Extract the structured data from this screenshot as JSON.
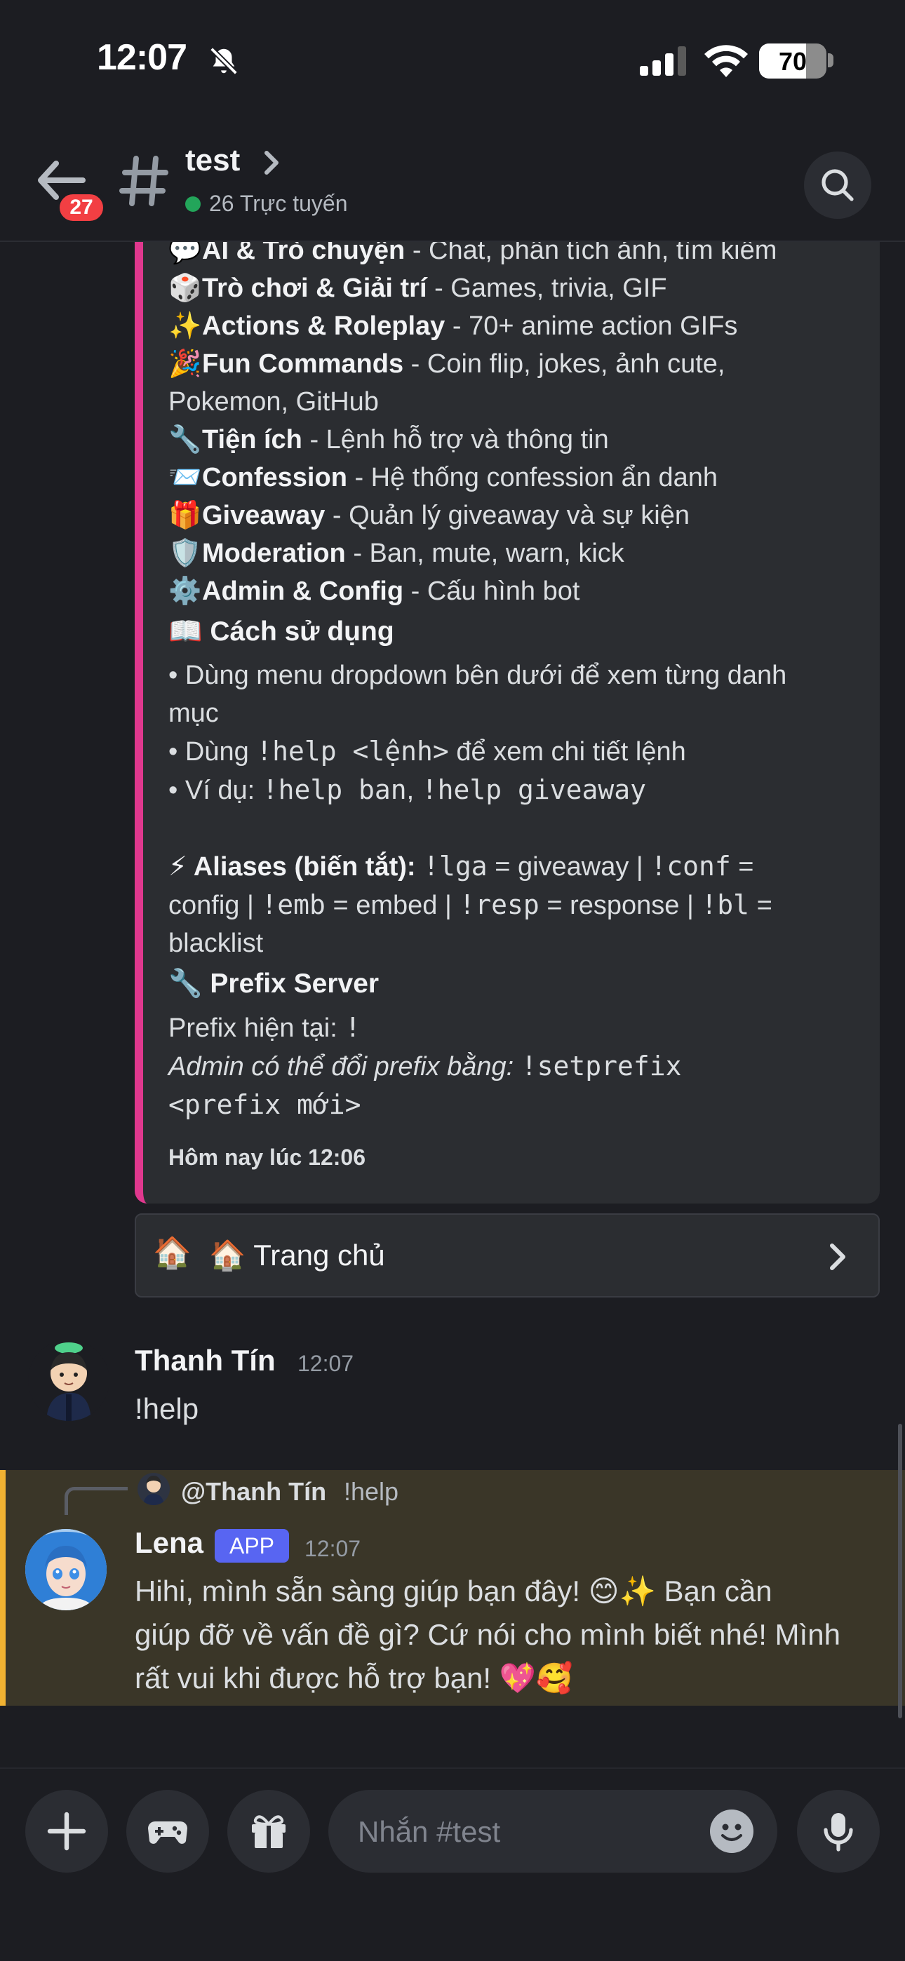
{
  "status_bar": {
    "time": "12:07",
    "battery_percent": 70
  },
  "header": {
    "unread_badge": "27",
    "channel_name": "test",
    "online_text": "26 Trực tuyến"
  },
  "embed": {
    "categories": [
      {
        "emoji": "💬",
        "name": "AI & Trò chuyện",
        "desc": " - Chat, phân tích ảnh, tìm kiếm"
      },
      {
        "emoji": "🎲",
        "name": "Trò chơi & Giải trí",
        "desc": " - Games, trivia, GIF"
      },
      {
        "emoji": "✨",
        "name": "Actions & Roleplay",
        "desc": " - 70+ anime action GIFs"
      },
      {
        "emoji": "🎉",
        "name": "Fun Commands",
        "desc": " - Coin flip, jokes, ảnh cute,"
      },
      {
        "emoji": "🔧",
        "name": "Tiện ích",
        "desc": " - Lệnh hỗ trợ và thông tin"
      },
      {
        "emoji": "📨",
        "name": "Confession",
        "desc": " - Hệ thống confession ẩn danh"
      },
      {
        "emoji": "🎁",
        "name": "Giveaway",
        "desc": " - Quản lý giveaway và sự kiện"
      },
      {
        "emoji": "🛡️",
        "name": "Moderation",
        "desc": " - Ban, mute, warn, kick"
      },
      {
        "emoji": "⚙️",
        "name": "Admin & Config",
        "desc": " - Cấu hình bot"
      }
    ],
    "fun_wrap": "Pokemon, GitHub",
    "usage_title": "📖 Cách sử dụng",
    "usage_1": "• Dùng menu dropdown bên dưới để xem từng danh",
    "usage_1b": "mục",
    "usage_2_pre": "• Dùng ",
    "usage_2_code": "!help <lệnh>",
    "usage_2_post": " để xem chi tiết lệnh",
    "usage_3_pre": "• Ví dụ: ",
    "usage_3_code1": "!help ban",
    "usage_3_sep": ", ",
    "usage_3_code2": "!help giveaway",
    "aliases_label": "⚡ Aliases (biến tắt):",
    "alias_lga": "!lga",
    "alias_lga_val": " = giveaway | ",
    "alias_conf": "!conf",
    "alias_conf_val": " =",
    "alias_conf_wrap": "config | ",
    "alias_emb": "!emb",
    "alias_emb_val": " = embed | ",
    "alias_resp": "!resp",
    "alias_resp_val": " = response | ",
    "alias_bl": "!bl",
    "alias_bl_val": " =",
    "alias_bl_wrap": "blacklist",
    "prefix_title": "🔧 Prefix Server",
    "prefix_current_label": "Prefix hiện tại: ",
    "prefix_current": "!",
    "prefix_admin_label": "Admin có thể đổi prefix bằng: ",
    "prefix_cmd": "!setprefix",
    "prefix_cmd_arg": "<prefix mới>",
    "footer": "Hôm nay lúc 12:06"
  },
  "select_menu": {
    "emoji": "🏠",
    "label": "🏠 Trang chủ"
  },
  "messages": [
    {
      "author": "Thanh Tín",
      "time": "12:07",
      "text": "!help"
    },
    {
      "author": "Lena",
      "tag": "APP",
      "time": "12:07",
      "reply_to": "@Thanh Tín",
      "reply_text": "!help",
      "line1": "Hihi, mình sẵn sàng giúp bạn đây! 😊✨ Bạn cần",
      "line2": "giúp đỡ về vấn đề gì? Cứ nói cho mình biết nhé! Mình",
      "line3": "rất vui khi được hỗ trợ bạn! 💖🥰"
    }
  ],
  "composer": {
    "placeholder": "Nhắn #test"
  },
  "colors": {
    "accent_bar": "#e0388e",
    "mention_bar": "#f0b232",
    "app_tag": "#5865f2",
    "online": "#23a55a"
  }
}
